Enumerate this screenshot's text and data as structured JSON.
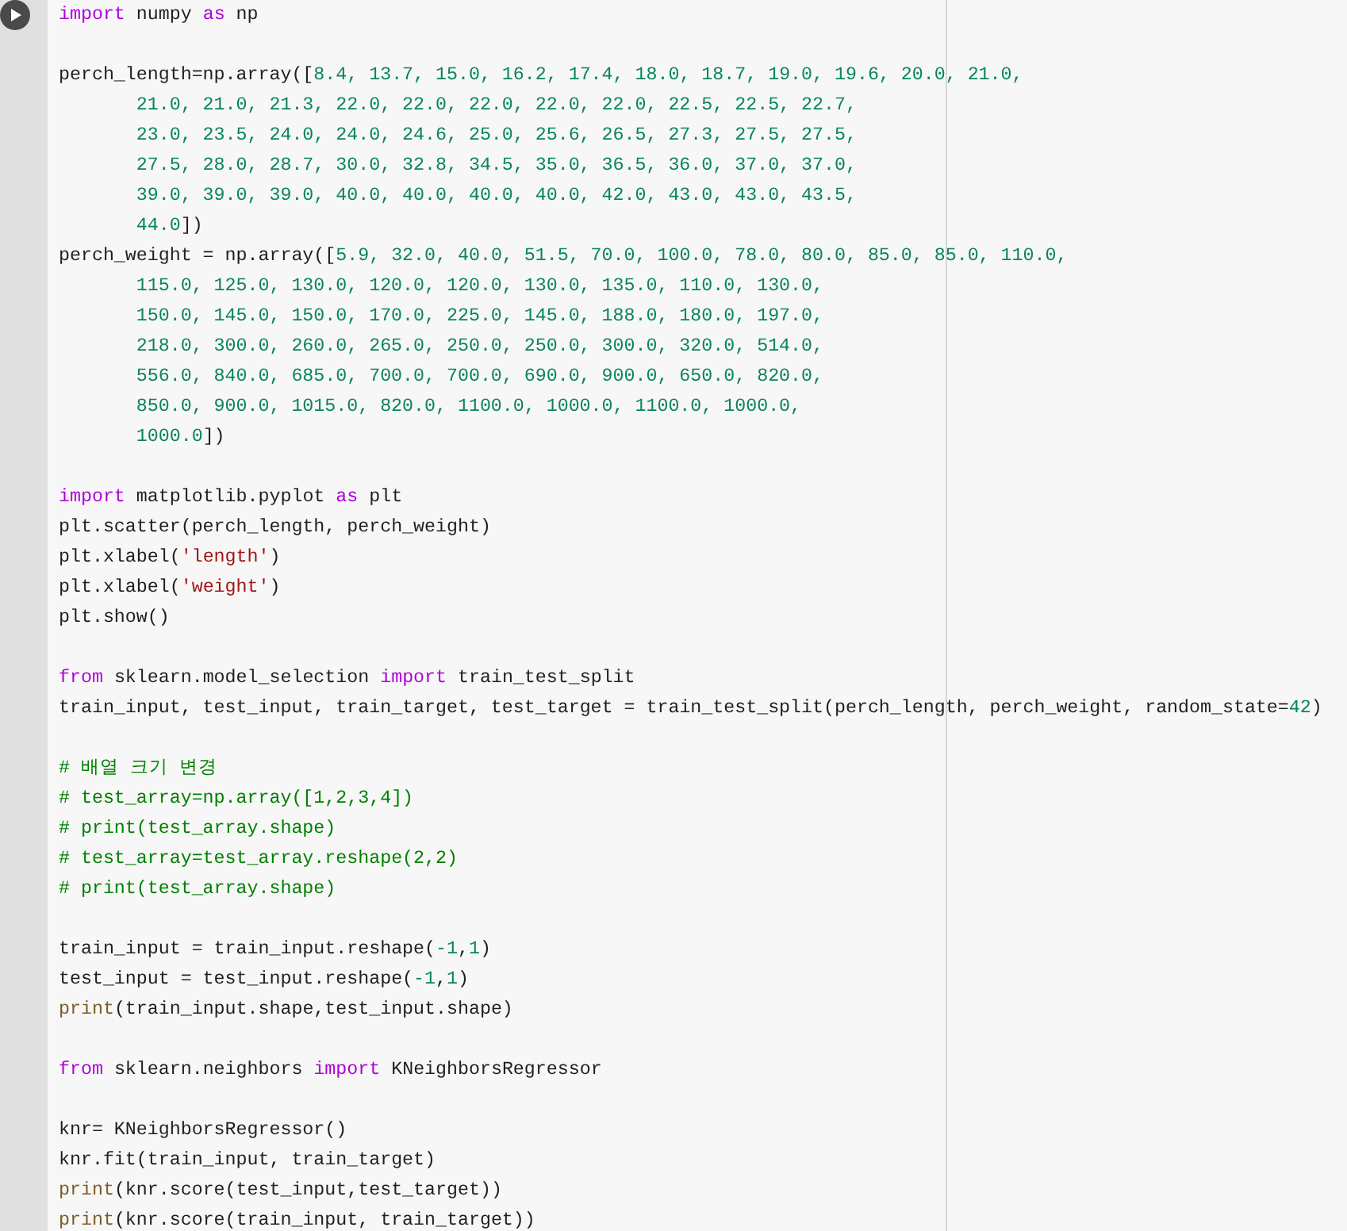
{
  "cell": {
    "blocks": [
      {
        "lines": [
          {
            "continued": false,
            "tokens": [
              {
                "kind": "keyword",
                "text": "import"
              },
              {
                "kind": "plain",
                "text": " numpy "
              },
              {
                "kind": "keyword",
                "text": "as"
              },
              {
                "kind": "plain",
                "text": " np"
              }
            ]
          }
        ]
      },
      {
        "lines": [
          {
            "continued": false,
            "tokens": [
              {
                "kind": "plain",
                "text": "perch_length=np.array(["
              },
              {
                "kind": "number",
                "text": "8.4, 13.7, 15.0, 16.2, 17.4, 18.0, 18.7, 19.0, 19.6, 20.0, 21.0,"
              }
            ]
          },
          {
            "continued": true,
            "tokens": [
              {
                "kind": "number",
                "text": "21.0, 21.0, 21.3, 22.0, 22.0, 22.0, 22.0, 22.0, 22.5, 22.5, 22.7,"
              }
            ]
          },
          {
            "continued": true,
            "tokens": [
              {
                "kind": "number",
                "text": "23.0, 23.5, 24.0, 24.0, 24.6, 25.0, 25.6, 26.5, 27.3, 27.5, 27.5,"
              }
            ]
          },
          {
            "continued": true,
            "tokens": [
              {
                "kind": "number",
                "text": "27.5, 28.0, 28.7, 30.0, 32.8, 34.5, 35.0, 36.5, 36.0, 37.0, 37.0,"
              }
            ]
          },
          {
            "continued": true,
            "tokens": [
              {
                "kind": "number",
                "text": "39.0, 39.0, 39.0, 40.0, 40.0, 40.0, 40.0, 42.0, 43.0, 43.0, 43.5,"
              }
            ]
          },
          {
            "continued": true,
            "tokens": [
              {
                "kind": "number",
                "text": "44.0"
              },
              {
                "kind": "plain",
                "text": "])"
              }
            ]
          },
          {
            "continued": false,
            "tokens": [
              {
                "kind": "plain",
                "text": "perch_weight = np.array(["
              },
              {
                "kind": "number",
                "text": "5.9, 32.0, 40.0, 51.5, 70.0, 100.0, 78.0, 80.0, 85.0, 85.0, 110.0,"
              }
            ]
          },
          {
            "continued": true,
            "tokens": [
              {
                "kind": "number",
                "text": "115.0, 125.0, 130.0, 120.0, 120.0, 130.0, 135.0, 110.0, 130.0,"
              }
            ]
          },
          {
            "continued": true,
            "tokens": [
              {
                "kind": "number",
                "text": "150.0, 145.0, 150.0, 170.0, 225.0, 145.0, 188.0, 180.0, 197.0,"
              }
            ]
          },
          {
            "continued": true,
            "tokens": [
              {
                "kind": "number",
                "text": "218.0, 300.0, 260.0, 265.0, 250.0, 250.0, 300.0, 320.0, 514.0,"
              }
            ]
          },
          {
            "continued": true,
            "tokens": [
              {
                "kind": "number",
                "text": "556.0, 840.0, 685.0, 700.0, 700.0, 690.0, 900.0, 650.0, 820.0,"
              }
            ]
          },
          {
            "continued": true,
            "tokens": [
              {
                "kind": "number",
                "text": "850.0, 900.0, 1015.0, 820.0, 1100.0, 1000.0, 1100.0, 1000.0,"
              }
            ]
          },
          {
            "continued": true,
            "tokens": [
              {
                "kind": "number",
                "text": "1000.0"
              },
              {
                "kind": "plain",
                "text": "])"
              }
            ]
          }
        ]
      },
      {
        "lines": [
          {
            "continued": false,
            "tokens": [
              {
                "kind": "keyword",
                "text": "import"
              },
              {
                "kind": "plain",
                "text": " matplotlib.pyplot "
              },
              {
                "kind": "keyword",
                "text": "as"
              },
              {
                "kind": "plain",
                "text": " plt"
              }
            ]
          },
          {
            "continued": false,
            "tokens": [
              {
                "kind": "plain",
                "text": "plt.scatter(perch_length, perch_weight)"
              }
            ]
          },
          {
            "continued": false,
            "tokens": [
              {
                "kind": "plain",
                "text": "plt.xlabel("
              },
              {
                "kind": "string",
                "text": "'length'"
              },
              {
                "kind": "plain",
                "text": ")"
              }
            ]
          },
          {
            "continued": false,
            "tokens": [
              {
                "kind": "plain",
                "text": "plt.xlabel("
              },
              {
                "kind": "string",
                "text": "'weight'"
              },
              {
                "kind": "plain",
                "text": ")"
              }
            ]
          },
          {
            "continued": false,
            "tokens": [
              {
                "kind": "plain",
                "text": "plt.show()"
              }
            ]
          }
        ]
      },
      {
        "lines": [
          {
            "continued": false,
            "tokens": [
              {
                "kind": "keyword",
                "text": "from"
              },
              {
                "kind": "plain",
                "text": " sklearn.model_selection "
              },
              {
                "kind": "keyword",
                "text": "import"
              },
              {
                "kind": "plain",
                "text": " train_test_split"
              }
            ]
          },
          {
            "continued": false,
            "tokens": [
              {
                "kind": "plain",
                "text": "train_input, test_input, train_target, test_target = train_test_split(perch_length, perch_weight, random_state="
              },
              {
                "kind": "number",
                "text": "42"
              },
              {
                "kind": "plain",
                "text": ")"
              }
            ]
          }
        ]
      },
      {
        "lines": [
          {
            "continued": false,
            "tokens": [
              {
                "kind": "comment",
                "text": "# 배열 크기 변경"
              }
            ]
          },
          {
            "continued": false,
            "tokens": [
              {
                "kind": "comment",
                "text": "# test_array=np.array([1,2,3,4])"
              }
            ]
          },
          {
            "continued": false,
            "tokens": [
              {
                "kind": "comment",
                "text": "# print(test_array.shape)"
              }
            ]
          },
          {
            "continued": false,
            "tokens": [
              {
                "kind": "comment",
                "text": "# test_array=test_array.reshape(2,2)"
              }
            ]
          },
          {
            "continued": false,
            "tokens": [
              {
                "kind": "comment",
                "text": "# print(test_array.shape)"
              }
            ]
          }
        ]
      },
      {
        "lines": [
          {
            "continued": false,
            "tokens": [
              {
                "kind": "plain",
                "text": "train_input = train_input.reshape("
              },
              {
                "kind": "number",
                "text": "-1"
              },
              {
                "kind": "plain",
                "text": ","
              },
              {
                "kind": "number",
                "text": "1"
              },
              {
                "kind": "plain",
                "text": ")"
              }
            ]
          },
          {
            "continued": false,
            "tokens": [
              {
                "kind": "plain",
                "text": "test_input = test_input.reshape("
              },
              {
                "kind": "number",
                "text": "-1"
              },
              {
                "kind": "plain",
                "text": ","
              },
              {
                "kind": "number",
                "text": "1"
              },
              {
                "kind": "plain",
                "text": ")"
              }
            ]
          },
          {
            "continued": false,
            "tokens": [
              {
                "kind": "builtin",
                "text": "print"
              },
              {
                "kind": "plain",
                "text": "(train_input.shape,test_input.shape)"
              }
            ]
          }
        ]
      },
      {
        "lines": [
          {
            "continued": false,
            "tokens": [
              {
                "kind": "keyword",
                "text": "from"
              },
              {
                "kind": "plain",
                "text": " sklearn.neighbors "
              },
              {
                "kind": "keyword",
                "text": "import"
              },
              {
                "kind": "plain",
                "text": " KNeighborsRegressor"
              }
            ]
          }
        ]
      },
      {
        "lines": [
          {
            "continued": false,
            "tokens": [
              {
                "kind": "plain",
                "text": "knr= KNeighborsRegressor()"
              }
            ]
          },
          {
            "continued": false,
            "tokens": [
              {
                "kind": "plain",
                "text": "knr.fit(train_input, train_target)"
              }
            ]
          },
          {
            "continued": false,
            "tokens": [
              {
                "kind": "builtin",
                "text": "print"
              },
              {
                "kind": "plain",
                "text": "(knr.score(test_input,test_target))"
              }
            ]
          },
          {
            "continued": false,
            "tokens": [
              {
                "kind": "builtin",
                "text": "print"
              },
              {
                "kind": "plain",
                "text": "(knr.score(train_input, train_target))"
              }
            ]
          }
        ]
      }
    ]
  }
}
